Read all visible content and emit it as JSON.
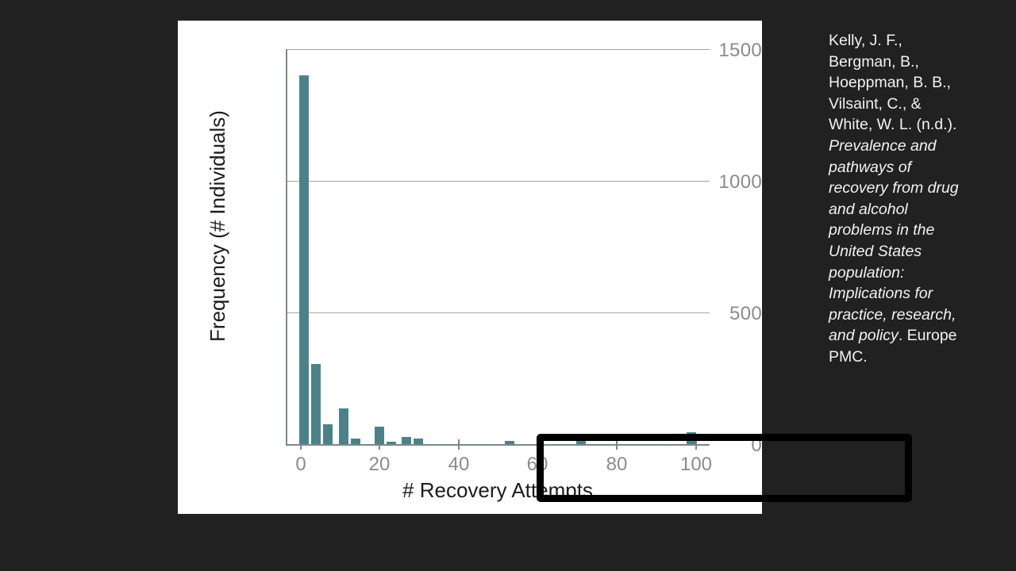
{
  "slide": {
    "background_color": "#212121",
    "card_background": "#ffffff"
  },
  "citation": {
    "authors_and_date": "Kelly, J. F., Bergman, B., Hoeppman, B. B., Vilsaint, C., & White, W. L. (n.d.). ",
    "title_italic": "Prevalence and pathways of recovery from drug and alcohol problems in the United States population: Implications for practice, research, and policy",
    "source": ". Europe PMC."
  },
  "annotation": {
    "highlight_box_label": "highlight-rectangle",
    "highlight_color": "#000000"
  },
  "chart_data": {
    "type": "bar",
    "title": "",
    "subtitle": "",
    "xlabel": "# Recovery Attempts",
    "ylabel": "Frequency (# Individuals)",
    "bar_color": "#4c8287",
    "grid": true,
    "grid_color": "#a6a6a6",
    "legend": null,
    "legend_position": "none",
    "xlim": [
      -3,
      107
    ],
    "ylim": [
      0,
      1500
    ],
    "xticks": [
      0,
      20,
      40,
      60,
      80,
      100
    ],
    "xtick_labels": [
      "0",
      "20",
      "40",
      "60",
      "80",
      "100"
    ],
    "yticks": [
      0,
      500,
      1000,
      1500
    ],
    "ytick_labels": [
      "0",
      "500",
      "1000",
      "1500"
    ],
    "bin_width": 2.4,
    "x": [
      1,
      4,
      7,
      11,
      14,
      20,
      23,
      27,
      30,
      53,
      71,
      99
    ],
    "values": [
      1400,
      305,
      75,
      135,
      22,
      65,
      10,
      26,
      22,
      12,
      18,
      45
    ],
    "bars": [
      {
        "x": 1,
        "value": 1400,
        "label": "1"
      },
      {
        "x": 4,
        "value": 305,
        "label": "4"
      },
      {
        "x": 7,
        "value": 75,
        "label": "7"
      },
      {
        "x": 11,
        "value": 135,
        "label": "11"
      },
      {
        "x": 14,
        "value": 22,
        "label": "14"
      },
      {
        "x": 20,
        "value": 65,
        "label": "20"
      },
      {
        "x": 23,
        "value": 10,
        "label": "23"
      },
      {
        "x": 27,
        "value": 26,
        "label": "27"
      },
      {
        "x": 30,
        "value": 22,
        "label": "30"
      },
      {
        "x": 53,
        "value": 12,
        "label": "53"
      },
      {
        "x": 71,
        "value": 18,
        "label": "71"
      },
      {
        "x": 99,
        "value": 45,
        "label": "99"
      }
    ],
    "annotations": [
      {
        "type": "rectangle",
        "x_range": [
          16,
          110
        ],
        "note": "black highlight box over the long tail of the distribution"
      }
    ]
  }
}
